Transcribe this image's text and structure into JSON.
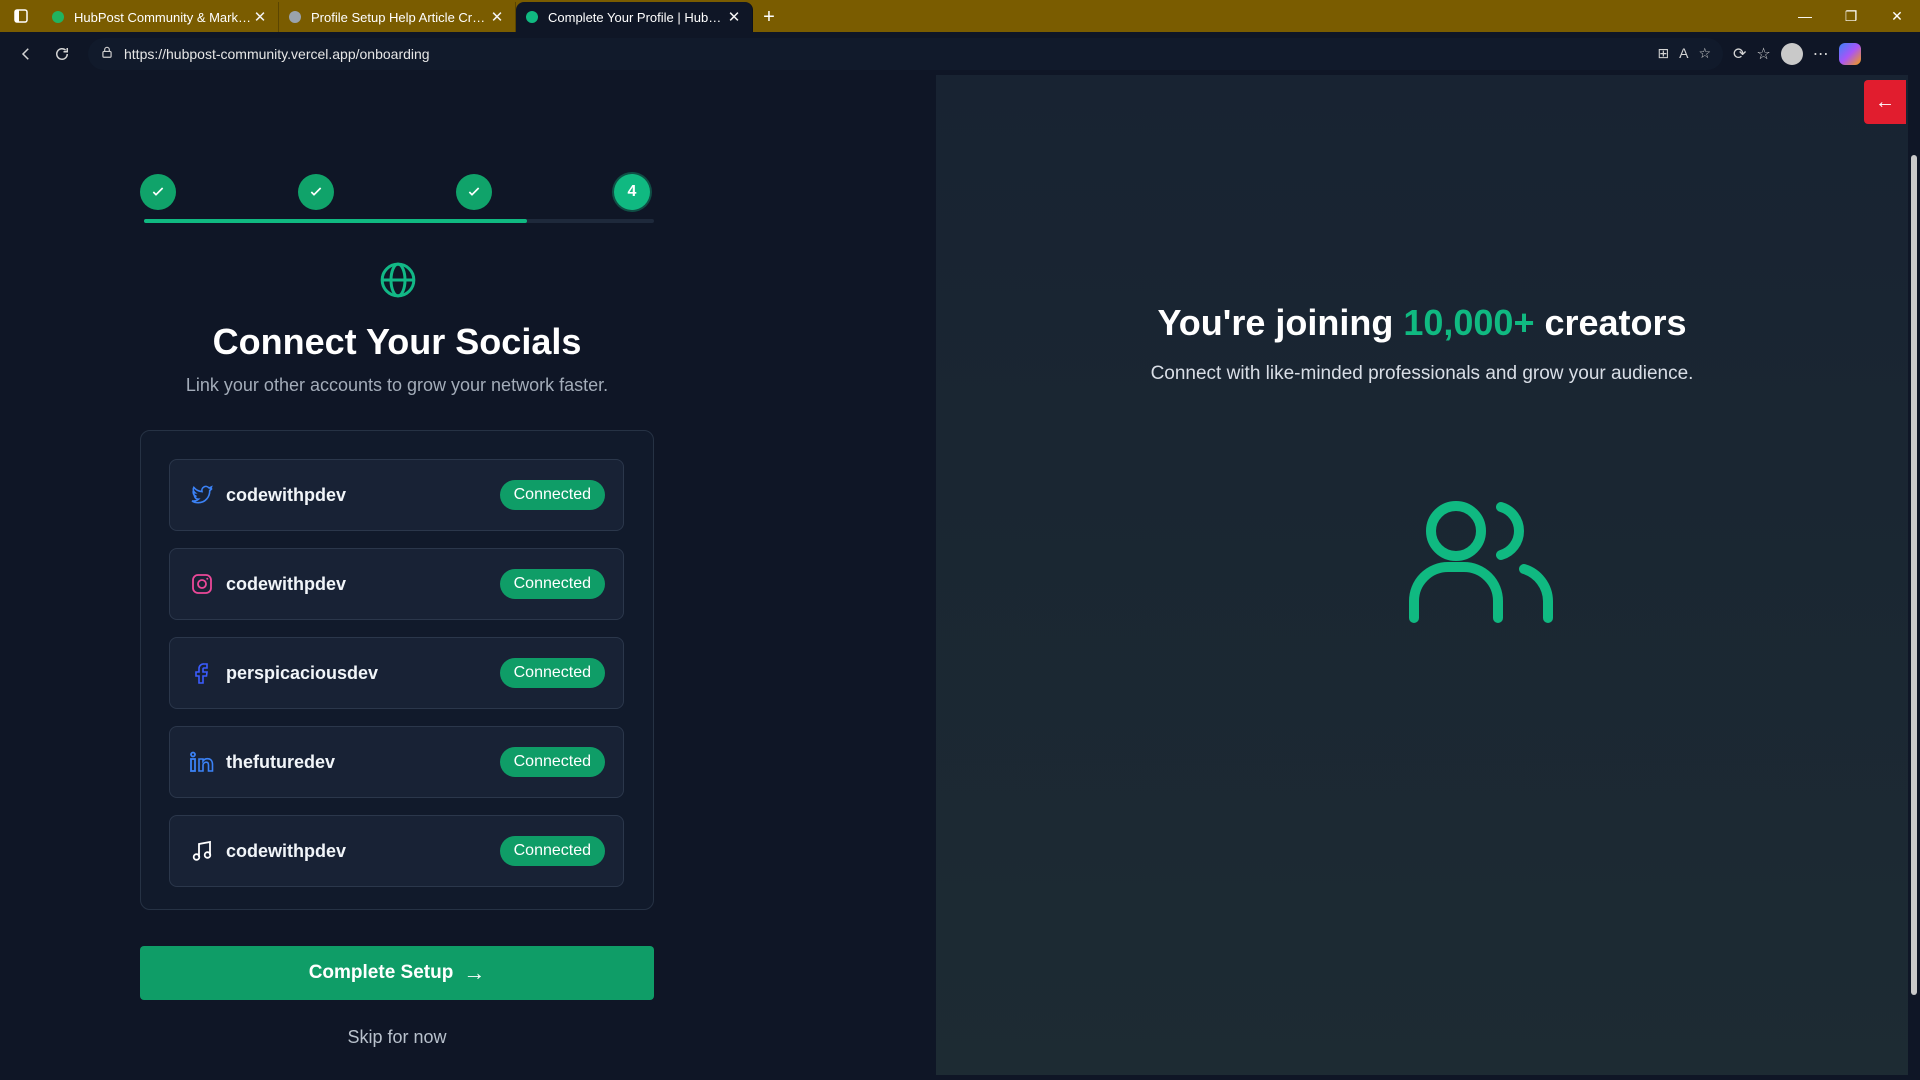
{
  "browser": {
    "tabs": [
      {
        "label": "HubPost Community & Marketpl…",
        "active": false
      },
      {
        "label": "Profile Setup Help Article Creatio…",
        "active": false
      },
      {
        "label": "Complete Your Profile | HubPost C…",
        "active": true
      }
    ],
    "url": "https://hubpost-community.vercel.app/onboarding"
  },
  "onboarding": {
    "steps": [
      {
        "state": "done"
      },
      {
        "state": "done"
      },
      {
        "state": "done"
      },
      {
        "state": "current",
        "label": "4"
      }
    ],
    "progress_fraction": 0.75,
    "title": "Connect Your Socials",
    "subtitle": "Link your other accounts to grow your network faster.",
    "accounts": [
      {
        "platform": "twitter-icon",
        "handle": "codewithpdev",
        "status": "Connected",
        "color": "#3b82f6"
      },
      {
        "platform": "instagram-icon",
        "handle": "codewithpdev",
        "status": "Connected",
        "color": "#ec4899"
      },
      {
        "platform": "facebook-icon",
        "handle": "perspicaciousdev",
        "status": "Connected",
        "color": "#3b5cff"
      },
      {
        "platform": "linkedin-icon",
        "handle": "thefuturedev",
        "status": "Connected",
        "color": "#3b82f6"
      },
      {
        "platform": "music-icon",
        "handle": "codewithpdev",
        "status": "Connected",
        "color": "#ffffff"
      }
    ],
    "cta": "Complete Setup",
    "skip": "Skip for now"
  },
  "hero": {
    "title_prefix": "You're joining ",
    "title_accent": "10,000+",
    "title_suffix": " creators",
    "subtitle": "Connect with like-minded professionals and grow your audience."
  },
  "colors": {
    "accent": "#10b981",
    "badge": "#0f9d67",
    "left_bg": "#0f1626",
    "right_bg": "#1b2833"
  }
}
